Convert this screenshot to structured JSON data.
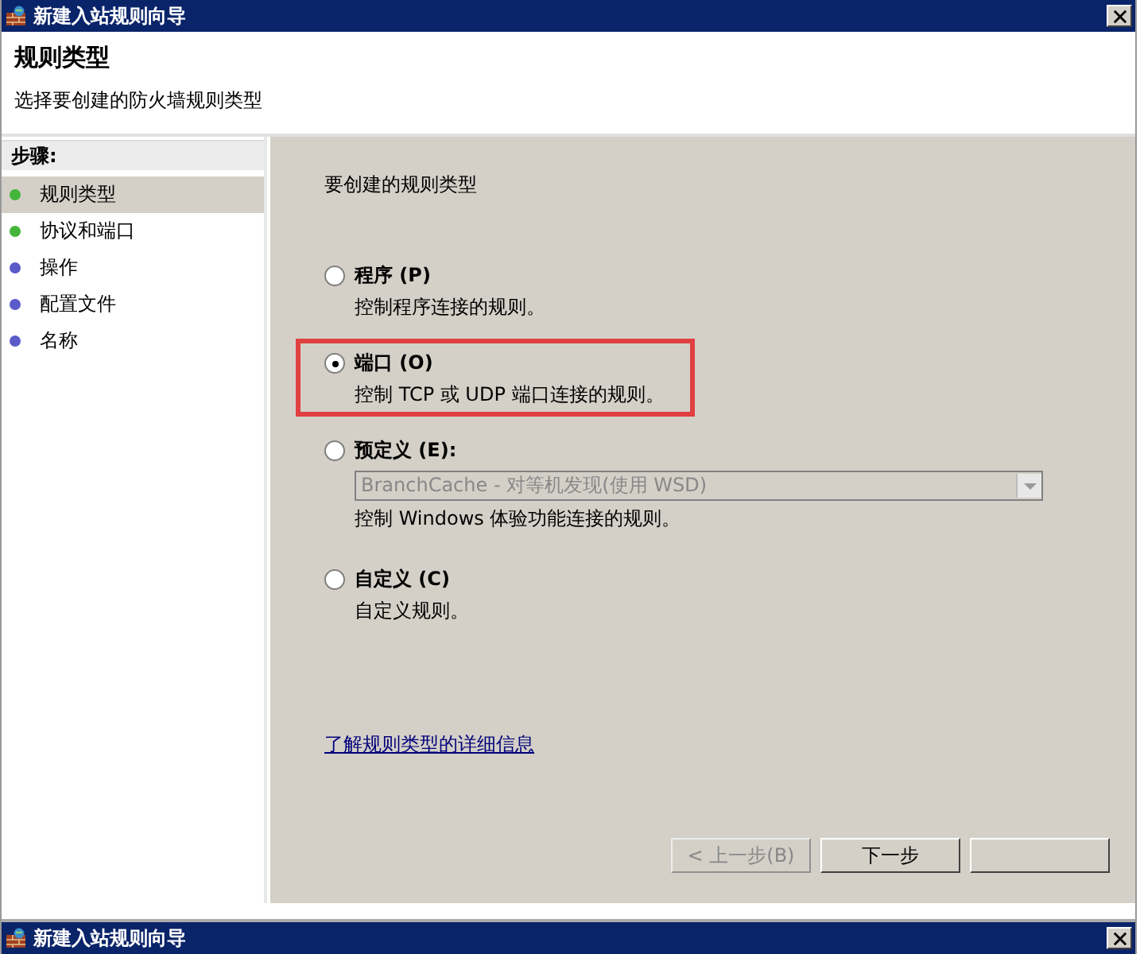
{
  "window": {
    "title": "新建入站规则向导"
  },
  "header": {
    "title": "规则类型",
    "subtitle": "选择要创建的防火墙规则类型"
  },
  "steps": {
    "heading": "步骤:",
    "items": [
      {
        "label": "规则类型",
        "selected": true,
        "color": "#44b53a"
      },
      {
        "label": "协议和端口",
        "selected": false,
        "color": "#44b53a"
      },
      {
        "label": "操作",
        "selected": false,
        "color": "#5a5ac8"
      },
      {
        "label": "配置文件",
        "selected": false,
        "color": "#5a5ac8"
      },
      {
        "label": "名称",
        "selected": false,
        "color": "#5a5ac8"
      }
    ]
  },
  "content": {
    "prompt": "要创建的规则类型",
    "options": [
      {
        "label": "程序",
        "key": "(P)",
        "description": "控制程序连接的规则。",
        "selected": false,
        "highlighted": false
      },
      {
        "label": "端口",
        "key": "(O)",
        "description": "控制 TCP 或 UDP 端口连接的规则。",
        "selected": true,
        "highlighted": true
      },
      {
        "label": "预定义",
        "key": "(E):",
        "dropdown": {
          "value": "BranchCache - 对等机发现(使用 WSD)",
          "disabled": true
        },
        "description": "控制 Windows 体验功能连接的规则。",
        "selected": false,
        "highlighted": false
      },
      {
        "label": "自定义",
        "key": "(C)",
        "description": "自定义规则。",
        "selected": false,
        "highlighted": false
      }
    ],
    "link": "了解规则类型的详细信息"
  },
  "buttons": [
    {
      "label": "< 上一步(B)",
      "disabled": true
    },
    {
      "label": "下一步",
      "disabled": false
    },
    {
      "disabled": false
    }
  ],
  "second_window": {
    "title": "新建入站规则向导"
  }
}
